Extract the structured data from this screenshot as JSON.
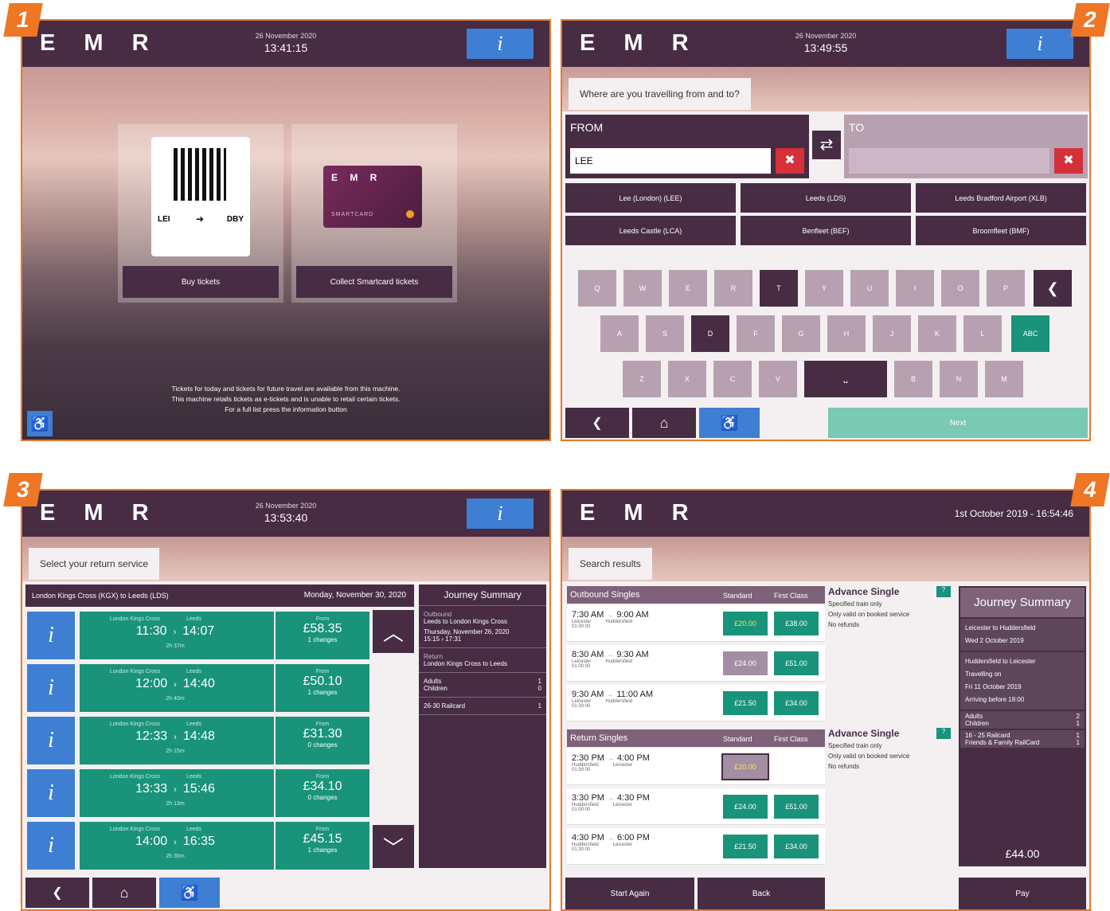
{
  "badges": [
    "1",
    "2",
    "3",
    "4"
  ],
  "logo": "E M R",
  "p1": {
    "date": "26 November 2020",
    "time": "13:41:15",
    "info": "i",
    "ticket_from": "LEI",
    "ticket_to": "DBY",
    "card_logo": "E M R",
    "card_label": "SMARTCARD",
    "buy": "Buy tickets",
    "collect": "Collect Smartcard tickets",
    "footer1": "Tickets for today and tickets for future travel are available from this machine.",
    "footer2": "This machine retails tickets as e-tickets and is unable to retail certain tickets.",
    "footer3": "For a full list press the information button"
  },
  "p2": {
    "date": "26 November 2020",
    "time": "13:49:55",
    "info": "i",
    "prompt": "Where are you travelling from and to?",
    "from": "FROM",
    "to": "TO",
    "from_value": "LEE",
    "to_value": "",
    "clear": "✖",
    "swap": "⇄",
    "suggestions": [
      "Lee (London) (LEE)",
      "Leeds (LDS)",
      "Leeds Bradford Airport (XLB)",
      "Leeds Castle (LCA)",
      "Benfleet (BEF)",
      "Broomfleet (BMF)"
    ],
    "keys_row1": [
      "Q",
      "W",
      "E",
      "R",
      "T",
      "Y",
      "U",
      "I",
      "O",
      "P"
    ],
    "keys_row2": [
      "A",
      "S",
      "D",
      "F",
      "G",
      "H",
      "J",
      "K",
      "L"
    ],
    "keys_row3": [
      "Z",
      "X",
      "C",
      "V",
      "␣",
      "B",
      "N",
      "M"
    ],
    "backspace": "❮",
    "abc": "ABC",
    "back": "❮",
    "home": "⌂",
    "access": "♿",
    "next": "Next"
  },
  "p3": {
    "date": "26 November 2020",
    "time": "13:53:40",
    "info": "i",
    "prompt": "Select your return service",
    "route": "London Kings Cross (KGX) to Leeds (LDS)",
    "route_date": "Monday, November 30, 2020",
    "services": [
      {
        "dep_stn": "London Kings Cross",
        "arr_stn": "Leeds",
        "dep": "11:30",
        "arr": "14:07",
        "dur": "2h 37m",
        "from": "From",
        "price": "£58.35",
        "changes": "1 changes"
      },
      {
        "dep_stn": "London Kings Cross",
        "arr_stn": "Leeds",
        "dep": "12:00",
        "arr": "14:40",
        "dur": "2h 40m",
        "from": "From",
        "price": "£50.10",
        "changes": "1 changes"
      },
      {
        "dep_stn": "London Kings Cross",
        "arr_stn": "Leeds",
        "dep": "12:33",
        "arr": "14:48",
        "dur": "2h 15m",
        "from": "From",
        "price": "£31.30",
        "changes": "0 changes"
      },
      {
        "dep_stn": "London Kings Cross",
        "arr_stn": "Leeds",
        "dep": "13:33",
        "arr": "15:46",
        "dur": "2h 13m",
        "from": "From",
        "price": "£34.10",
        "changes": "0 changes"
      },
      {
        "dep_stn": "London Kings Cross",
        "arr_stn": "Leeds",
        "dep": "14:00",
        "arr": "16:35",
        "dur": "2h 35m",
        "from": "From",
        "price": "£45.15",
        "changes": "1 changes"
      }
    ],
    "summary_title": "Journey Summary",
    "out_label": "Outbound",
    "out_route": "Leeds to London Kings Cross",
    "out_date": "Thursday, November 26, 2020",
    "out_times": "15:15 › 17:31",
    "ret_label": "Return",
    "ret_route": "London Kings Cross to Leeds",
    "adults": "Adults",
    "adults_n": "1",
    "children": "Children",
    "children_n": "0",
    "railcard": "26-30 Railcard",
    "railcard_n": "1",
    "back": "❮",
    "home": "⌂",
    "access": "♿"
  },
  "p4": {
    "datetime": "1st October 2019 - 16:54:46",
    "prompt": "Search results",
    "out_hdr": "Outbound Singles",
    "ret_hdr": "Return Singles",
    "std": "Standard",
    "first": "First Class",
    "out_rows": [
      {
        "dep": "7:30 AM",
        "arr": "9:00 AM",
        "from": "Leicester",
        "to": "Huddersfield",
        "dur": "01:30:00",
        "std": "£20.00",
        "fc": "£38.00"
      },
      {
        "dep": "8:30 AM",
        "arr": "9:30 AM",
        "from": "Leicester",
        "to": "Huddersfield",
        "dur": "01:00:00",
        "std": "£24.00",
        "fc": "£51.00"
      },
      {
        "dep": "9:30 AM",
        "arr": "11:00 AM",
        "from": "Leicester",
        "to": "Huddersfield",
        "dur": "01:30:00",
        "std": "£21.50",
        "fc": "£34.00"
      }
    ],
    "ret_rows": [
      {
        "dep": "2:30 PM",
        "arr": "4:00 PM",
        "from": "Huddersfield",
        "to": "Leicester",
        "dur": "01:30:00",
        "std": "£20.00",
        "fc": ""
      },
      {
        "dep": "3:30 PM",
        "arr": "4:30 PM",
        "from": "Huddersfield",
        "to": "Leicester",
        "dur": "01:00:00",
        "std": "£24.00",
        "fc": "£51.00"
      },
      {
        "dep": "4:30 PM",
        "arr": "6:00 PM",
        "from": "Huddersfield",
        "to": "Leicester",
        "dur": "01:30:00",
        "std": "£21.50",
        "fc": "£34.00"
      }
    ],
    "adv_title": "Advance Single",
    "adv_q": "?",
    "adv1": "Specified train only",
    "adv2": "Only valid on booked service",
    "adv3": "No refunds",
    "summary_title": "Journey Summary",
    "s1": "Leicester to Huddersfield",
    "s2": "Wed 2 October 2019",
    "s3": "Huddersfield to Leicester",
    "s4": "Travelling on",
    "s5": "Fri 11 October 2019",
    "s6": "Arriving before 18:00",
    "adults": "Adults",
    "adults_n": "2",
    "children": "Children",
    "children_n": "1",
    "rc1": "16 - 25 Railcard",
    "rc1_n": "1",
    "rc2": "Friends & Family RailCard",
    "rc2_n": "1",
    "total": "£44.00",
    "start_again": "Start Again",
    "back": "Back",
    "pay": "Pay"
  },
  "colors": {
    "brand": "#472c44",
    "accent": "#19937a",
    "info": "#3e7fd3",
    "badge": "#ee7624"
  }
}
